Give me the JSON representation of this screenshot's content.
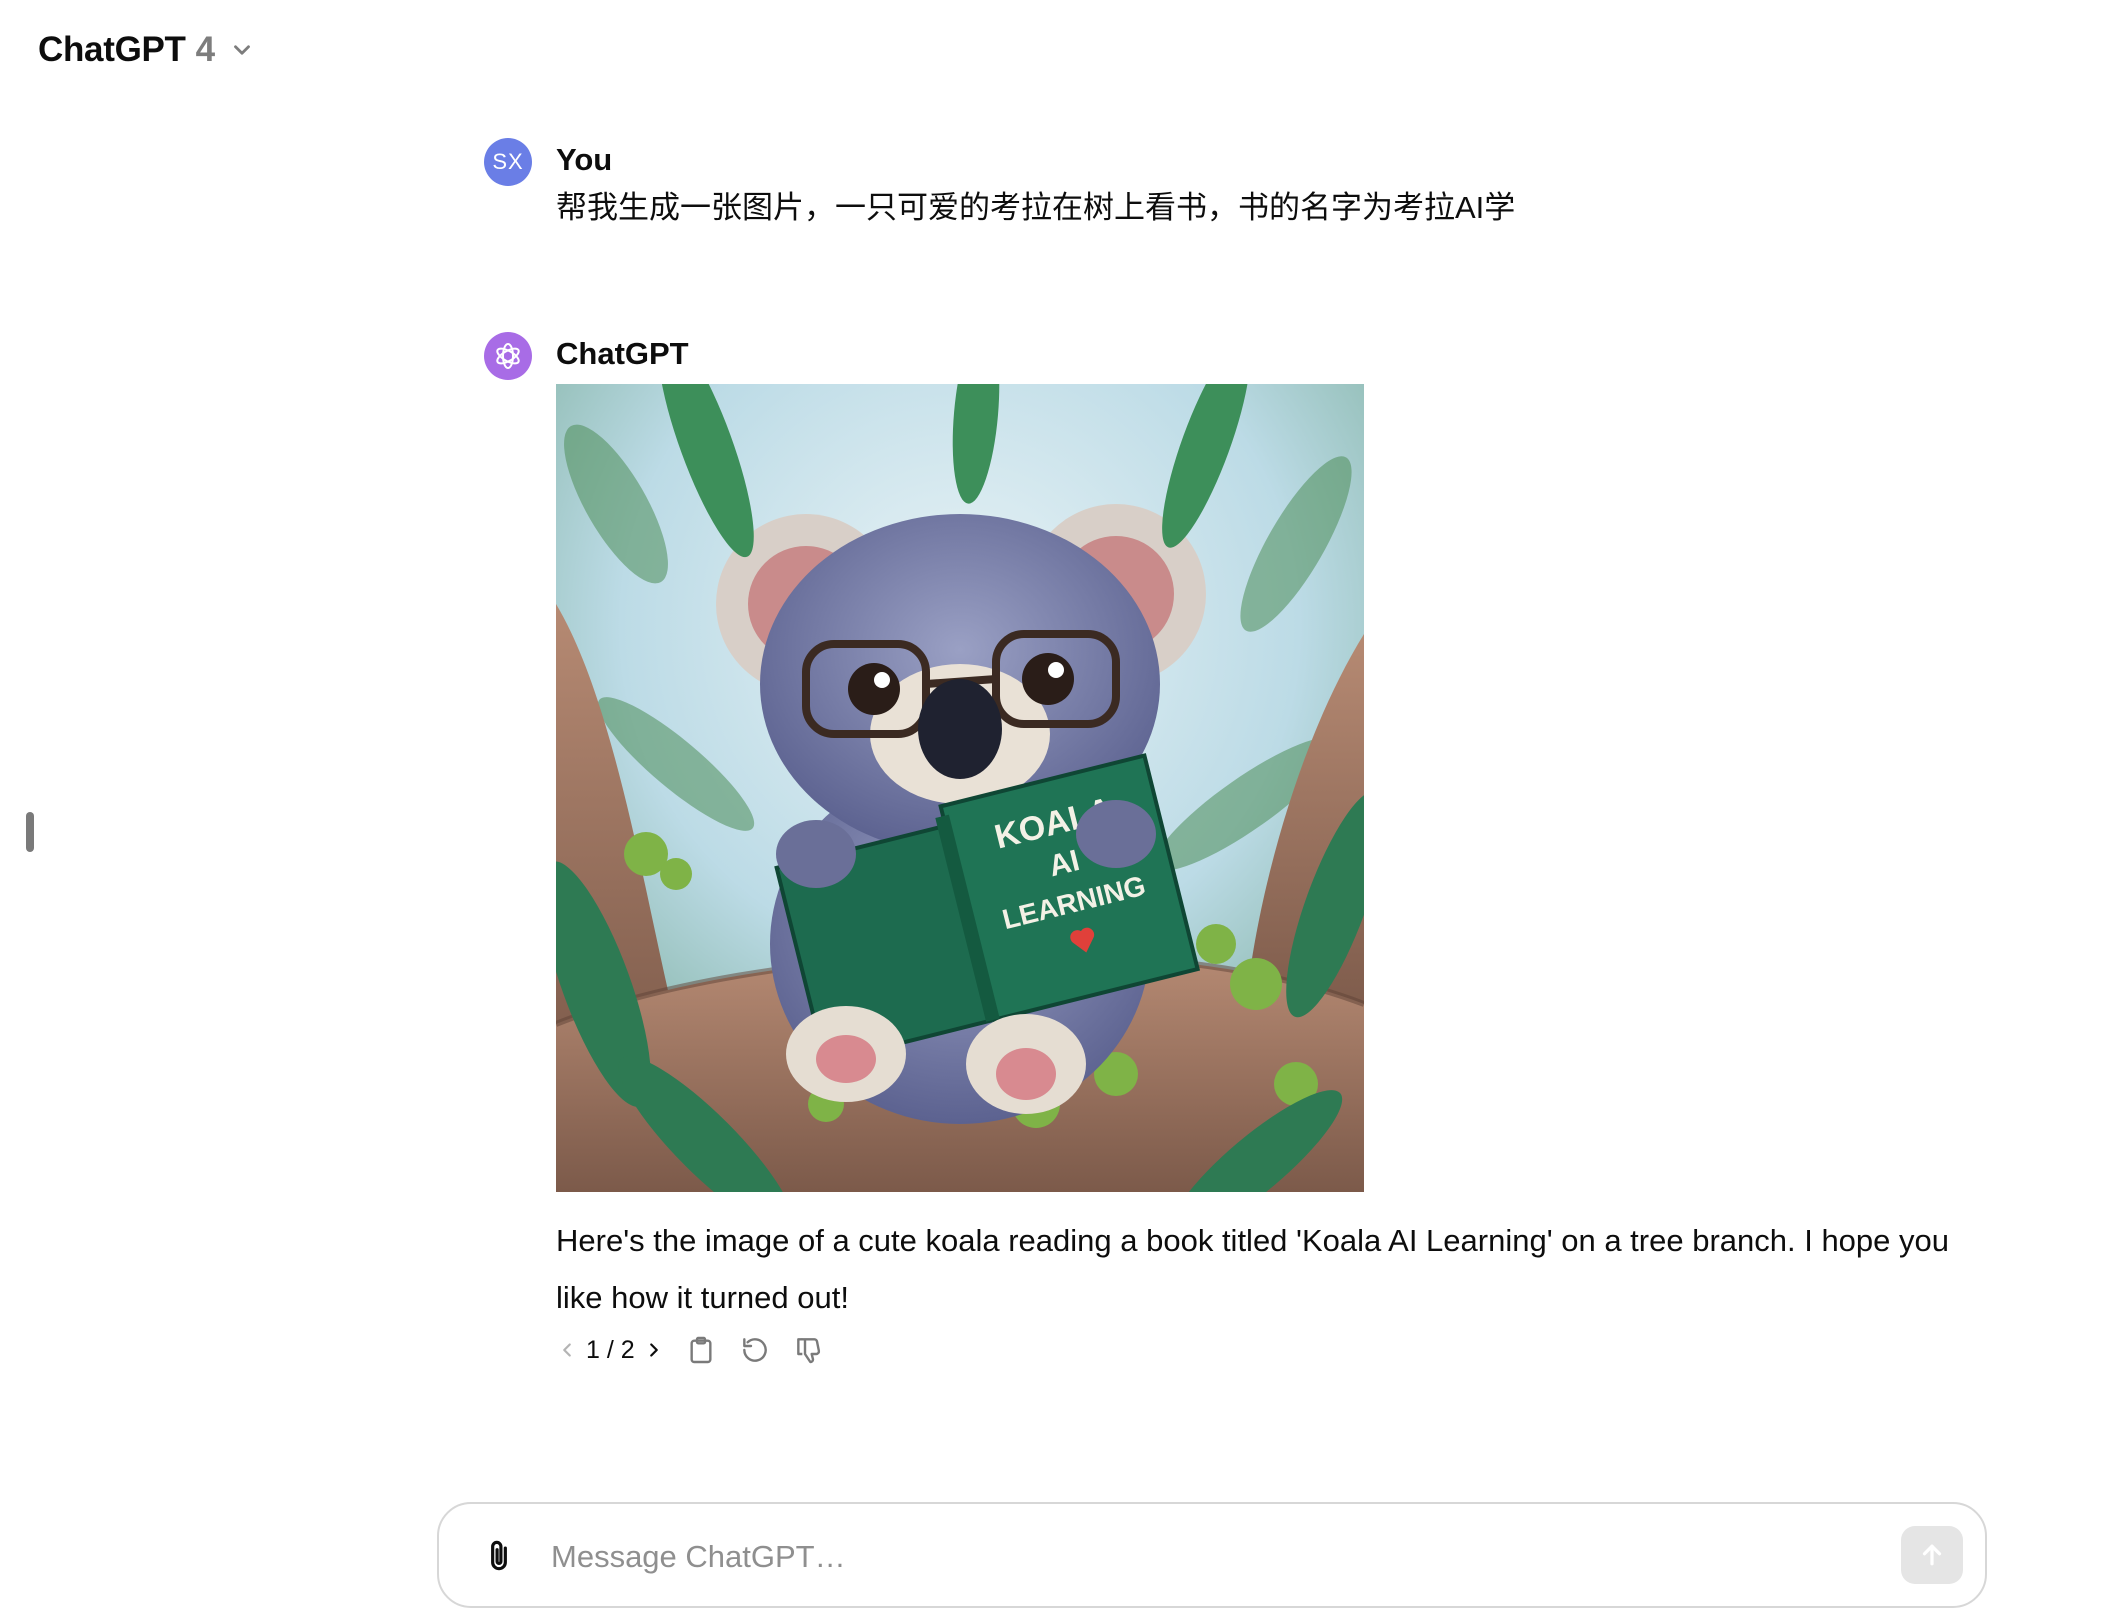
{
  "header": {
    "model_name": "ChatGPT",
    "model_version": "4"
  },
  "conversation": {
    "user": {
      "avatar_initials": "SX",
      "author": "You",
      "text": "帮我生成一张图片，一只可爱的考拉在树上看书，书的名字为考拉AI学"
    },
    "assistant": {
      "author": "ChatGPT",
      "image": {
        "book_title_lines": [
          "KOALA",
          "AI",
          "LEARNING"
        ]
      },
      "text": "Here's the image of a cute koala reading a book titled 'Koala AI Learning' on a tree branch. I hope you like how it turned out!",
      "pager": "1 / 2"
    }
  },
  "composer": {
    "placeholder": "Message ChatGPT…"
  },
  "icons": {
    "model_chevron": "chevron-down-icon",
    "gpt_logo": "openai-logo-icon",
    "prev": "chevron-left-icon",
    "next": "chevron-right-icon",
    "copy": "clipboard-icon",
    "regenerate": "refresh-icon",
    "dislike": "thumbs-down-icon",
    "attach": "paperclip-icon",
    "send": "arrow-up-icon"
  },
  "colors": {
    "user_avatar": "#6a7ee6",
    "gpt_avatar": "#a86ce6",
    "send_disabled": "#e5e5e5"
  }
}
